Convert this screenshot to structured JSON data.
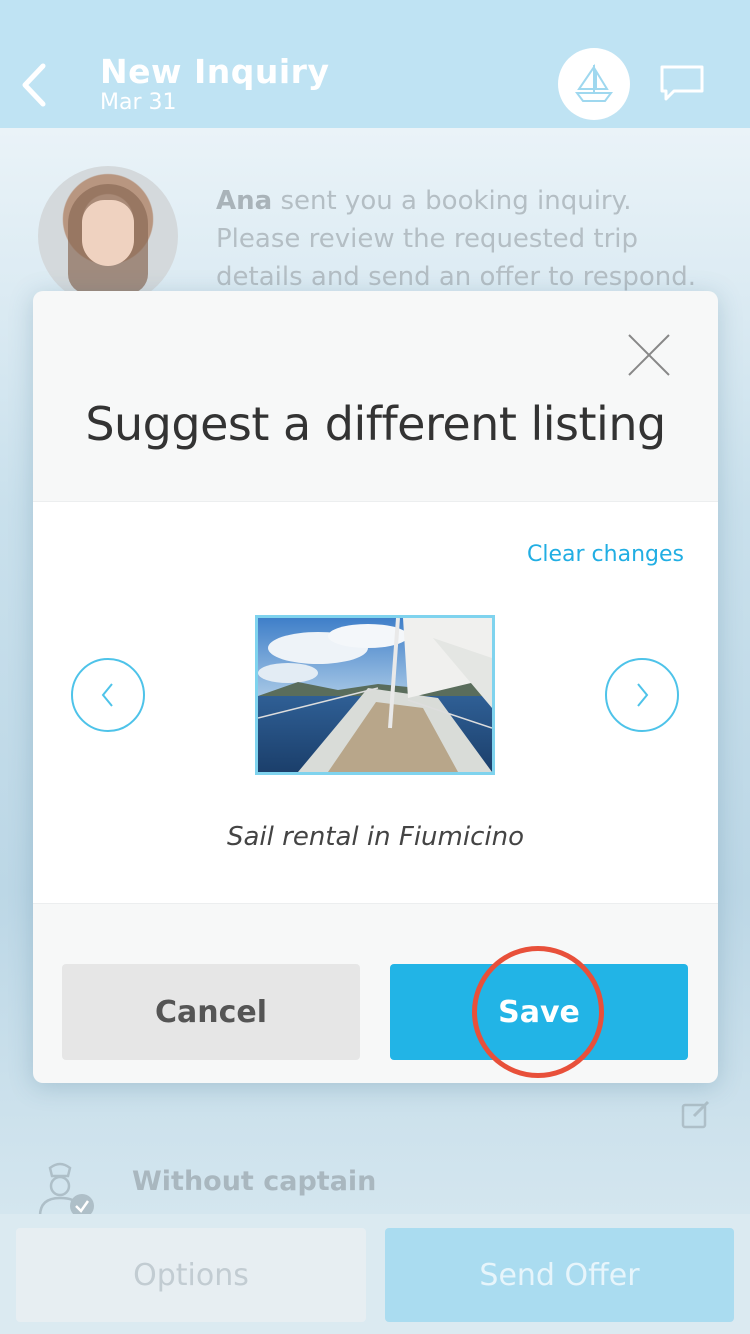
{
  "header": {
    "title": "New Inquiry",
    "date": "Mar 31"
  },
  "inquiry": {
    "sender": "Ana",
    "message": " sent you a booking inquiry. Please review the requested trip details and send an offer to respond."
  },
  "trip": {
    "captain_label": "Without captain"
  },
  "bottom_bar": {
    "options_label": "Options",
    "send_offer_label": "Send Offer"
  },
  "modal": {
    "title": "Suggest a different listing",
    "clear_link": "Clear changes",
    "listing_caption": "Sail rental in Fiumicino",
    "cancel_label": "Cancel",
    "save_label": "Save"
  },
  "colors": {
    "accent": "#22b4e6",
    "highlight_ring": "#e8503a",
    "header_bg": "#bfe3f3"
  },
  "icons": {
    "back": "chevron-left-icon",
    "boat": "sailboat-icon",
    "chat": "chat-bubble-icon",
    "close": "close-icon",
    "prev": "chevron-left-icon",
    "next": "chevron-right-icon",
    "edit": "edit-icon",
    "captain": "captain-icon"
  }
}
